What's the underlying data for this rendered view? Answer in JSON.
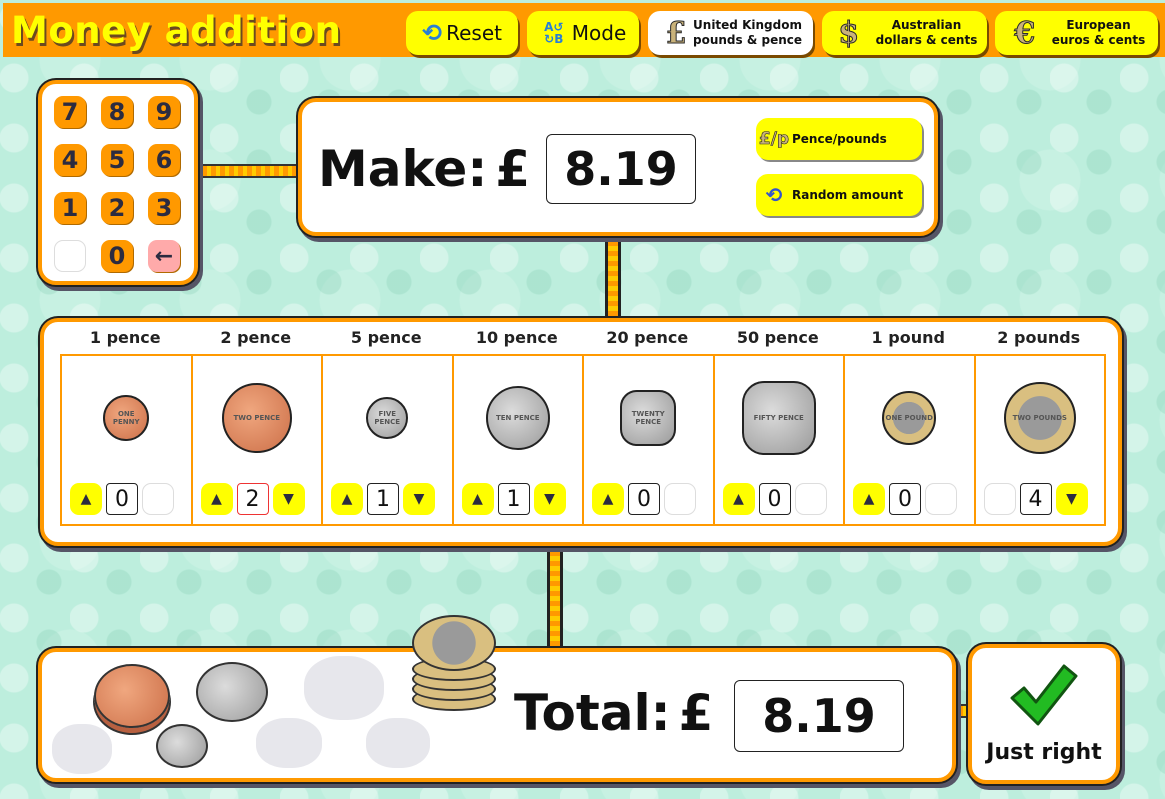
{
  "header": {
    "title": "Money addition",
    "buttons": [
      {
        "id": "reset",
        "label": "Reset",
        "icon": "reset-icon"
      },
      {
        "id": "mode",
        "label": "Mode",
        "icon": "mode-swap-icon"
      },
      {
        "id": "uk",
        "line1": "United Kingdom",
        "line2": "pounds & pence",
        "icon": "pound-icon",
        "glyph": "£",
        "selected": true
      },
      {
        "id": "aus",
        "line1": "Australian",
        "line2": "dollars & cents",
        "icon": "dollar-icon",
        "glyph": "$",
        "selected": false
      },
      {
        "id": "eur",
        "line1": "European",
        "line2": "euros & cents",
        "icon": "euro-icon",
        "glyph": "€",
        "selected": false
      }
    ]
  },
  "keypad": {
    "keys": [
      "7",
      "8",
      "9",
      "4",
      "5",
      "6",
      "1",
      "2",
      "3",
      "",
      "0",
      "←"
    ]
  },
  "make": {
    "label": "Make:",
    "currency_symbol": "£",
    "amount": "8.19",
    "pence_pounds_label": "Pence/pounds",
    "pence_pounds_icon": "£/p",
    "random_label": "Random amount",
    "random_icon": "⟲"
  },
  "coins": [
    {
      "label": "1 pence",
      "count": "0",
      "up_enabled": true,
      "down_enabled": false,
      "style": "copper",
      "engraving": "ONE PENNY"
    },
    {
      "label": "2 pence",
      "count": "2",
      "up_enabled": true,
      "down_enabled": true,
      "style": "copper",
      "engraving": "TWO PENCE",
      "active": true
    },
    {
      "label": "5 pence",
      "count": "1",
      "up_enabled": true,
      "down_enabled": true,
      "style": "silver",
      "engraving": "FIVE PENCE"
    },
    {
      "label": "10 pence",
      "count": "1",
      "up_enabled": true,
      "down_enabled": true,
      "style": "silver",
      "engraving": "TEN PENCE"
    },
    {
      "label": "20 pence",
      "count": "0",
      "up_enabled": true,
      "down_enabled": false,
      "style": "silver hept",
      "engraving": "TWENTY PENCE"
    },
    {
      "label": "50 pence",
      "count": "0",
      "up_enabled": true,
      "down_enabled": false,
      "style": "silver hept",
      "engraving": "FIFTY PENCE"
    },
    {
      "label": "1 pound",
      "count": "0",
      "up_enabled": true,
      "down_enabled": false,
      "style": "bimetal",
      "engraving": "ONE POUND"
    },
    {
      "label": "2 pounds",
      "count": "4",
      "up_enabled": false,
      "down_enabled": true,
      "style": "bimetal",
      "engraving": "TWO POUNDS"
    }
  ],
  "stepper_glyphs": {
    "up": "▲",
    "down": "▼"
  },
  "total": {
    "label": "Total:",
    "currency_symbol": "£",
    "amount": "8.19"
  },
  "result": {
    "label": "Just right",
    "status_color": "#22aa22"
  },
  "colors": {
    "accent_orange": "#ff9900",
    "button_yellow": "#ffff00",
    "title_yellow": "#ffff00",
    "background_mint": "#bdeedd"
  }
}
